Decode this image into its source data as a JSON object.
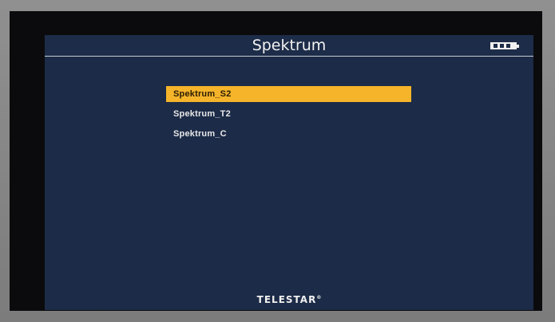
{
  "screen": {
    "title": "Spektrum",
    "battery_icon": "battery-icon",
    "menu": {
      "items": [
        {
          "label": "Spektrum_S2",
          "selected": true
        },
        {
          "label": "Spektrum_T2",
          "selected": false
        },
        {
          "label": "Spektrum_C",
          "selected": false
        }
      ]
    },
    "brand": "TELESTAR",
    "brand_mark": "®"
  },
  "colors": {
    "background": "#1c2b47",
    "highlight": "#f5b42a",
    "text": "#e8e8e8"
  }
}
